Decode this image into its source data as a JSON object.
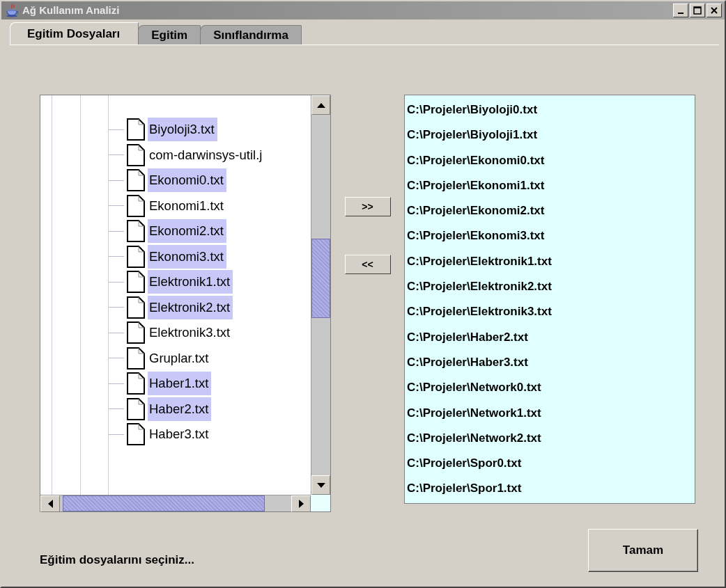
{
  "window": {
    "title": "Ağ Kullanım Analizi"
  },
  "tabs": [
    {
      "label": "Egitim Dosyaları",
      "selected": true
    },
    {
      "label": "Egitim",
      "selected": false
    },
    {
      "label": "Sınıflandırma",
      "selected": false
    }
  ],
  "tree": {
    "items": [
      {
        "label": "Biyoloji3.txt",
        "selected": true
      },
      {
        "label": "com-darwinsys-util.j",
        "selected": false
      },
      {
        "label": "Ekonomi0.txt",
        "selected": true
      },
      {
        "label": "Ekonomi1.txt",
        "selected": false
      },
      {
        "label": "Ekonomi2.txt",
        "selected": true
      },
      {
        "label": "Ekonomi3.txt",
        "selected": true
      },
      {
        "label": "Elektronik1.txt",
        "selected": true
      },
      {
        "label": "Elektronik2.txt",
        "selected": true
      },
      {
        "label": "Elektronik3.txt",
        "selected": false
      },
      {
        "label": "Gruplar.txt",
        "selected": false
      },
      {
        "label": "Haber1.txt",
        "selected": true
      },
      {
        "label": "Haber2.txt",
        "selected": true
      },
      {
        "label": "Haber3.txt",
        "selected": false
      }
    ]
  },
  "move_buttons": [
    ">>",
    "<<"
  ],
  "chosen_files": [
    "C:\\Projeler\\Biyoloji0.txt",
    "C:\\Projeler\\Biyoloji1.txt",
    "C:\\Projeler\\Ekonomi0.txt",
    "C:\\Projeler\\Ekonomi1.txt",
    "C:\\Projeler\\Ekonomi2.txt",
    "C:\\Projeler\\Ekonomi3.txt",
    "C:\\Projeler\\Elektronik1.txt",
    "C:\\Projeler\\Elektronik2.txt",
    "C:\\Projeler\\Elektronik3.txt",
    "C:\\Projeler\\Haber2.txt",
    "C:\\Projeler\\Haber3.txt",
    "C:\\Projeler\\Network0.txt",
    "C:\\Projeler\\Network1.txt",
    "C:\\Projeler\\Network2.txt",
    "C:\\Projeler\\Spor0.txt",
    "C:\\Projeler\\Spor1.txt"
  ],
  "status": "Eğitim dosyalarını seçiniz...",
  "ok_button": "Tamam"
}
